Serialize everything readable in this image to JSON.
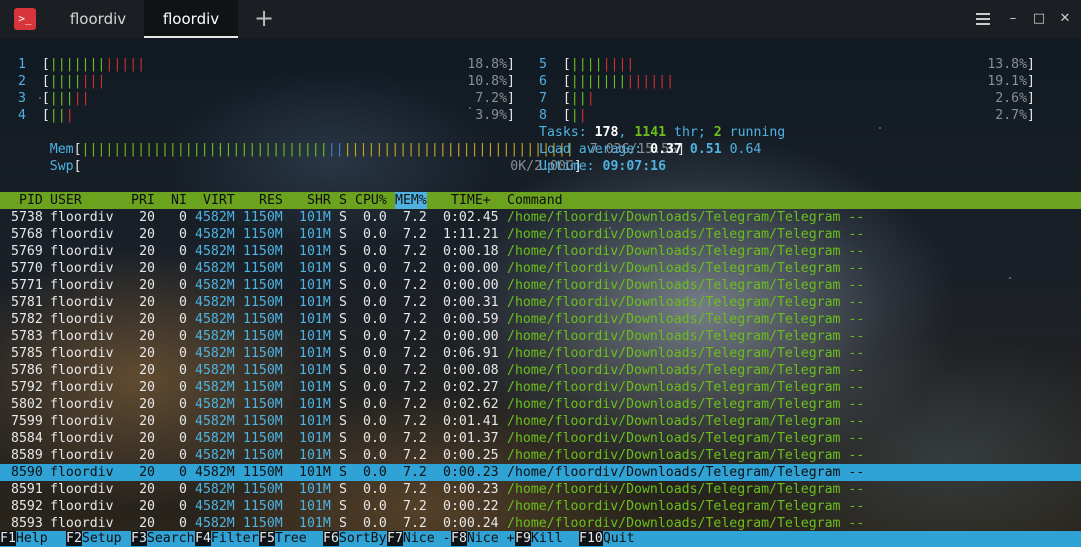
{
  "tabs": [
    {
      "label": "floordiv",
      "active": false
    },
    {
      "label": "floordiv",
      "active": true
    }
  ],
  "app_icon": "terminal-icon",
  "new_tab_glyph": "+",
  "window_controls": [
    "menu-icon",
    "minimize-icon",
    "maximize-icon",
    "close-icon"
  ],
  "colors": {
    "header_bg": "#6ba31e",
    "selection_bg": "#2fa3d6",
    "cyan": "#4fb3e2",
    "app_icon": "#d8353a"
  },
  "cpus": [
    {
      "id": "1",
      "bars": "||||||||||||",
      "pct": "18.8%"
    },
    {
      "id": "2",
      "bars": "|||||||",
      "pct": "10.8%"
    },
    {
      "id": "3",
      "bars": "|||||",
      "pct": "7.2%"
    },
    {
      "id": "4",
      "bars": "|||",
      "pct": "3.9%"
    },
    {
      "id": "5",
      "bars": "||||||||",
      "pct": "13.8%"
    },
    {
      "id": "6",
      "bars": "|||||||||||||",
      "pct": "19.1%"
    },
    {
      "id": "7",
      "bars": "|||",
      "pct": "2.6%"
    },
    {
      "id": "8",
      "bars": "||",
      "pct": "2.7%"
    }
  ],
  "mem": {
    "label": "Mem",
    "value": "7.03G/15.5G"
  },
  "swp": {
    "label": "Swp",
    "value": "0K/2.00G"
  },
  "tasks": {
    "label": "Tasks:",
    "count": "178",
    "sep": ",",
    "thr": "1141",
    "thr_label": "thr;",
    "running": "2",
    "running_label": "running"
  },
  "load": {
    "label": "Load average:",
    "v1": "0.37",
    "v5": "0.51",
    "v15": "0.64"
  },
  "uptime": {
    "label": "Uptime:",
    "value": "09:07:16"
  },
  "columns": [
    "PID",
    "USER",
    "PRI",
    "NI",
    "VIRT",
    "RES",
    "SHR",
    "S",
    "CPU%",
    "MEM%",
    "TIME+",
    "Command"
  ],
  "processes": [
    {
      "pid": "5738",
      "user": "floordiv",
      "pri": "20",
      "ni": "0",
      "virt": "4582M",
      "res": "1150M",
      "shr": "101M",
      "s": "S",
      "cpu": "0.0",
      "mem": "7.2",
      "time": "0:02.45",
      "cmd": "/home/floordiv/Downloads/Telegram/Telegram --"
    },
    {
      "pid": "5768",
      "user": "floordiv",
      "pri": "20",
      "ni": "0",
      "virt": "4582M",
      "res": "1150M",
      "shr": "101M",
      "s": "S",
      "cpu": "0.0",
      "mem": "7.2",
      "time": "1:11.21",
      "cmd": "/home/floordiv/Downloads/Telegram/Telegram --"
    },
    {
      "pid": "5769",
      "user": "floordiv",
      "pri": "20",
      "ni": "0",
      "virt": "4582M",
      "res": "1150M",
      "shr": "101M",
      "s": "S",
      "cpu": "0.0",
      "mem": "7.2",
      "time": "0:00.18",
      "cmd": "/home/floordiv/Downloads/Telegram/Telegram --"
    },
    {
      "pid": "5770",
      "user": "floordiv",
      "pri": "20",
      "ni": "0",
      "virt": "4582M",
      "res": "1150M",
      "shr": "101M",
      "s": "S",
      "cpu": "0.0",
      "mem": "7.2",
      "time": "0:00.00",
      "cmd": "/home/floordiv/Downloads/Telegram/Telegram --"
    },
    {
      "pid": "5771",
      "user": "floordiv",
      "pri": "20",
      "ni": "0",
      "virt": "4582M",
      "res": "1150M",
      "shr": "101M",
      "s": "S",
      "cpu": "0.0",
      "mem": "7.2",
      "time": "0:00.00",
      "cmd": "/home/floordiv/Downloads/Telegram/Telegram --"
    },
    {
      "pid": "5781",
      "user": "floordiv",
      "pri": "20",
      "ni": "0",
      "virt": "4582M",
      "res": "1150M",
      "shr": "101M",
      "s": "S",
      "cpu": "0.0",
      "mem": "7.2",
      "time": "0:00.31",
      "cmd": "/home/floordiv/Downloads/Telegram/Telegram --"
    },
    {
      "pid": "5782",
      "user": "floordiv",
      "pri": "20",
      "ni": "0",
      "virt": "4582M",
      "res": "1150M",
      "shr": "101M",
      "s": "S",
      "cpu": "0.0",
      "mem": "7.2",
      "time": "0:00.59",
      "cmd": "/home/floordiv/Downloads/Telegram/Telegram --"
    },
    {
      "pid": "5783",
      "user": "floordiv",
      "pri": "20",
      "ni": "0",
      "virt": "4582M",
      "res": "1150M",
      "shr": "101M",
      "s": "S",
      "cpu": "0.0",
      "mem": "7.2",
      "time": "0:00.00",
      "cmd": "/home/floordiv/Downloads/Telegram/Telegram --"
    },
    {
      "pid": "5785",
      "user": "floordiv",
      "pri": "20",
      "ni": "0",
      "virt": "4582M",
      "res": "1150M",
      "shr": "101M",
      "s": "S",
      "cpu": "0.0",
      "mem": "7.2",
      "time": "0:06.91",
      "cmd": "/home/floordiv/Downloads/Telegram/Telegram --"
    },
    {
      "pid": "5786",
      "user": "floordiv",
      "pri": "20",
      "ni": "0",
      "virt": "4582M",
      "res": "1150M",
      "shr": "101M",
      "s": "S",
      "cpu": "0.0",
      "mem": "7.2",
      "time": "0:00.08",
      "cmd": "/home/floordiv/Downloads/Telegram/Telegram --"
    },
    {
      "pid": "5792",
      "user": "floordiv",
      "pri": "20",
      "ni": "0",
      "virt": "4582M",
      "res": "1150M",
      "shr": "101M",
      "s": "S",
      "cpu": "0.0",
      "mem": "7.2",
      "time": "0:02.27",
      "cmd": "/home/floordiv/Downloads/Telegram/Telegram --"
    },
    {
      "pid": "5802",
      "user": "floordiv",
      "pri": "20",
      "ni": "0",
      "virt": "4582M",
      "res": "1150M",
      "shr": "101M",
      "s": "S",
      "cpu": "0.0",
      "mem": "7.2",
      "time": "0:02.62",
      "cmd": "/home/floordiv/Downloads/Telegram/Telegram --"
    },
    {
      "pid": "7599",
      "user": "floordiv",
      "pri": "20",
      "ni": "0",
      "virt": "4582M",
      "res": "1150M",
      "shr": "101M",
      "s": "S",
      "cpu": "0.0",
      "mem": "7.2",
      "time": "0:01.41",
      "cmd": "/home/floordiv/Downloads/Telegram/Telegram --"
    },
    {
      "pid": "8584",
      "user": "floordiv",
      "pri": "20",
      "ni": "0",
      "virt": "4582M",
      "res": "1150M",
      "shr": "101M",
      "s": "S",
      "cpu": "0.0",
      "mem": "7.2",
      "time": "0:01.37",
      "cmd": "/home/floordiv/Downloads/Telegram/Telegram --"
    },
    {
      "pid": "8589",
      "user": "floordiv",
      "pri": "20",
      "ni": "0",
      "virt": "4582M",
      "res": "1150M",
      "shr": "101M",
      "s": "S",
      "cpu": "0.0",
      "mem": "7.2",
      "time": "0:00.25",
      "cmd": "/home/floordiv/Downloads/Telegram/Telegram --"
    },
    {
      "pid": "8590",
      "user": "floordiv",
      "pri": "20",
      "ni": "0",
      "virt": "4582M",
      "res": "1150M",
      "shr": "101M",
      "s": "S",
      "cpu": "0.0",
      "mem": "7.2",
      "time": "0:00.23",
      "cmd": "/home/floordiv/Downloads/Telegram/Telegram --",
      "selected": true
    },
    {
      "pid": "8591",
      "user": "floordiv",
      "pri": "20",
      "ni": "0",
      "virt": "4582M",
      "res": "1150M",
      "shr": "101M",
      "s": "S",
      "cpu": "0.0",
      "mem": "7.2",
      "time": "0:00.23",
      "cmd": "/home/floordiv/Downloads/Telegram/Telegram --"
    },
    {
      "pid": "8592",
      "user": "floordiv",
      "pri": "20",
      "ni": "0",
      "virt": "4582M",
      "res": "1150M",
      "shr": "101M",
      "s": "S",
      "cpu": "0.0",
      "mem": "7.2",
      "time": "0:00.22",
      "cmd": "/home/floordiv/Downloads/Telegram/Telegram --"
    },
    {
      "pid": "8593",
      "user": "floordiv",
      "pri": "20",
      "ni": "0",
      "virt": "4582M",
      "res": "1150M",
      "shr": "101M",
      "s": "S",
      "cpu": "0.0",
      "mem": "7.2",
      "time": "0:00.24",
      "cmd": "/home/floordiv/Downloads/Telegram/Telegram --"
    }
  ],
  "function_keys": [
    {
      "key": "F1",
      "label": "Help"
    },
    {
      "key": "F2",
      "label": "Setup"
    },
    {
      "key": "F3",
      "label": "Search"
    },
    {
      "key": "F4",
      "label": "Filter"
    },
    {
      "key": "F5",
      "label": "Tree"
    },
    {
      "key": "F6",
      "label": "SortBy"
    },
    {
      "key": "F7",
      "label": "Nice -"
    },
    {
      "key": "F8",
      "label": "Nice +"
    },
    {
      "key": "F9",
      "label": "Kill"
    },
    {
      "key": "F10",
      "label": "Quit"
    }
  ]
}
